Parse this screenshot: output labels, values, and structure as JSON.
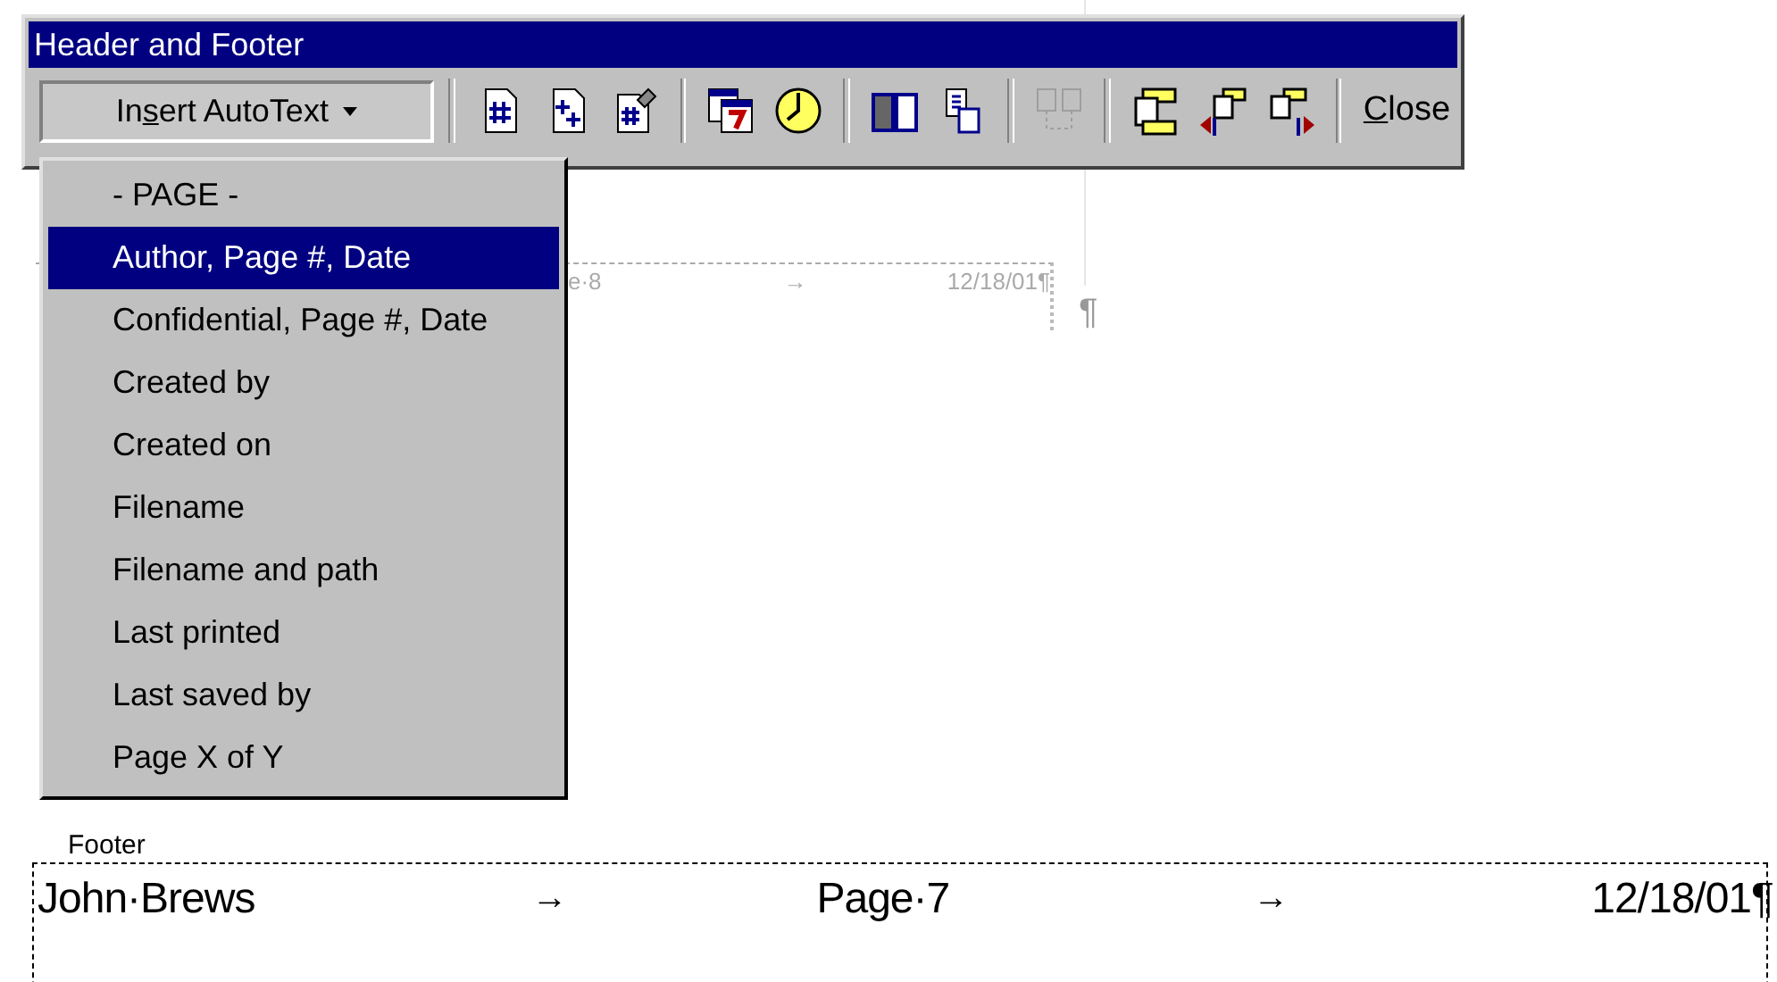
{
  "window": {
    "title": "Header and Footer"
  },
  "toolbar": {
    "autotext_button": {
      "label_before": "In",
      "access_key": "s",
      "label_after": "ert AutoText",
      "pressed": true
    },
    "tools": [
      {
        "kind": "page-number",
        "disabled": false,
        "group_start": true
      },
      {
        "kind": "page-count",
        "disabled": false,
        "group_start": false
      },
      {
        "kind": "format-page-number",
        "disabled": false,
        "group_start": false
      },
      {
        "kind": "date",
        "disabled": false,
        "group_start": true
      },
      {
        "kind": "time",
        "disabled": false,
        "group_start": false
      },
      {
        "kind": "page-setup",
        "disabled": false,
        "group_start": true
      },
      {
        "kind": "show-hide",
        "disabled": false,
        "group_start": false
      },
      {
        "kind": "same-as-previous",
        "disabled": true,
        "group_start": true
      },
      {
        "kind": "switch",
        "disabled": false,
        "group_start": true
      },
      {
        "kind": "show-previous",
        "disabled": false,
        "group_start": false
      },
      {
        "kind": "show-next",
        "disabled": false,
        "group_start": false
      }
    ],
    "close_button": {
      "access_key": "C",
      "label_after": "lose"
    }
  },
  "autotext_menu": [
    {
      "label": "- PAGE -",
      "selected": false
    },
    {
      "label": "Author, Page #, Date",
      "selected": true
    },
    {
      "label": "Confidential, Page #, Date",
      "selected": false
    },
    {
      "label": "Created by",
      "selected": false
    },
    {
      "label": "Created on",
      "selected": false
    },
    {
      "label": "Filename",
      "selected": false
    },
    {
      "label": "Filename and path",
      "selected": false
    },
    {
      "label": "Last printed",
      "selected": false
    },
    {
      "label": "Last saved by",
      "selected": false
    },
    {
      "label": "Page X of Y",
      "selected": false
    }
  ],
  "header_behind": {
    "left": "e·8",
    "tab": "→",
    "right": "12/18/01¶",
    "mark": "¶"
  },
  "footer": {
    "label": "Footer",
    "left": "John·Brews",
    "tab_1": "→",
    "center": "Page·7",
    "tab_2": "→",
    "right": "12/18/01¶"
  }
}
